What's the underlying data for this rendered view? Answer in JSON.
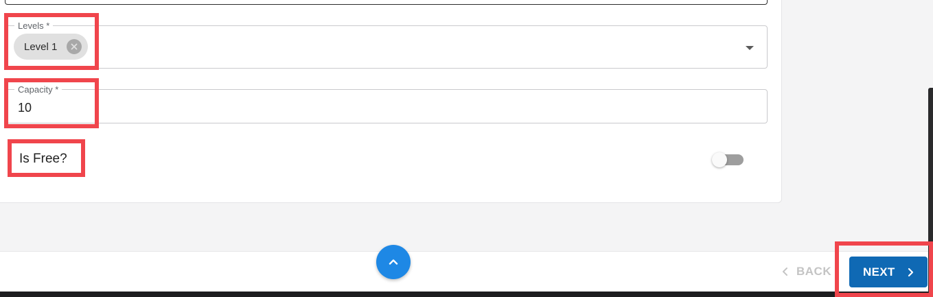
{
  "form": {
    "levels": {
      "label": "Levels *",
      "selected_chip": "Level 1"
    },
    "capacity": {
      "label": "Capacity *",
      "value": "10"
    },
    "is_free": {
      "label": "Is Free?",
      "checked": false
    }
  },
  "footer": {
    "back_label": "BACK",
    "next_label": "NEXT"
  },
  "colors": {
    "primary": "#0f69b4",
    "scroll_top_button": "#1e88e5",
    "highlight": "#f0454c",
    "toggle_off": "#9e9e9e"
  },
  "icons": [
    "cancel-icon",
    "dropdown-arrow-icon",
    "chevron-up-icon",
    "chevron-left-icon",
    "chevron-right-icon"
  ]
}
